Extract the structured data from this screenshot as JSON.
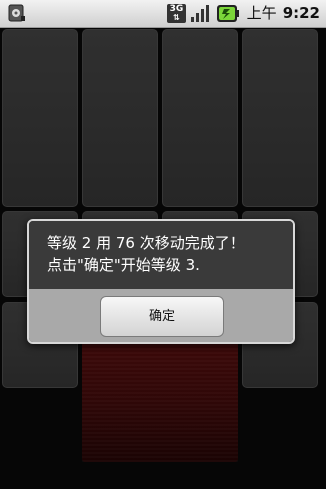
{
  "status_bar": {
    "network_label": "3G",
    "ampm": "上午",
    "time": "9:22"
  },
  "dialog": {
    "message_line1": "等级 2 用 76 次移动完成了！",
    "message_line2": "点击\"确定\"开始等级 3.",
    "ok_label": "确定"
  },
  "board": {
    "empty_slot_color": "#5a0e0e",
    "tile_color": "#444444"
  },
  "icons": {
    "left_status": "sd-card-icon",
    "network": "3g-data-icon",
    "signal": "signal-strength-icon",
    "battery": "battery-charging-icon"
  }
}
